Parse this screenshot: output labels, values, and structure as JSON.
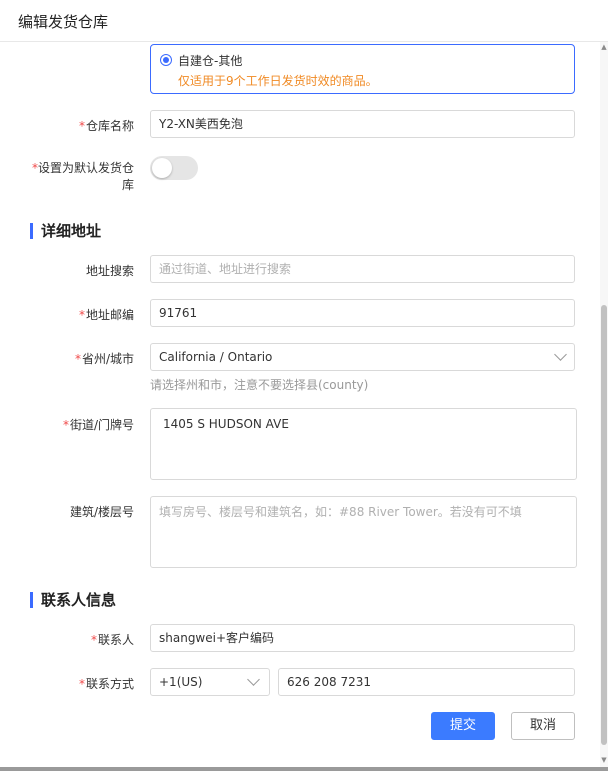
{
  "dialog": {
    "title": "编辑发货仓库"
  },
  "warehouse_type": {
    "selected_label": "自建仓-其他",
    "description": "仅适用于9个工作日发货时效的商品。",
    "description_color": "#f08a24"
  },
  "fields": {
    "warehouse_name": {
      "label": "仓库名称",
      "value": "Y2-XN美西免泡"
    },
    "default_warehouse": {
      "label": "设置为默认发货仓库",
      "enabled": false
    },
    "address_search": {
      "label": "地址搜索",
      "placeholder": "通过街道、地址进行搜索"
    },
    "postal_code": {
      "label": "地址邮编",
      "value": "91761"
    },
    "state_city": {
      "label": "省州/城市",
      "value": "California / Ontario",
      "hint": "请选择州和市，注意不要选择县(county)"
    },
    "street": {
      "label": "街道/门牌号",
      "value": "1405 S HUDSON AVE"
    },
    "building": {
      "label": "建筑/楼层号",
      "placeholder": "填写房号、楼层号和建筑名，如：#88 River Tower。若没有可不填"
    },
    "contact_name": {
      "label": "联系人",
      "value": "shangwei+客户编码"
    },
    "contact_method": {
      "label": "联系方式",
      "country_code": "+1(US)",
      "phone": "626 208 7231"
    }
  },
  "sections": {
    "address_detail": "详细地址",
    "contact_info": "联系人信息"
  },
  "buttons": {
    "submit": "提交",
    "cancel": "取消"
  },
  "colors": {
    "accent": "#3b6bff",
    "required": "#f04a4a",
    "primary_button": "#3b7bff"
  },
  "icons": {
    "dropdown": "chevron-down-icon",
    "radio": "radio-selected-icon"
  }
}
